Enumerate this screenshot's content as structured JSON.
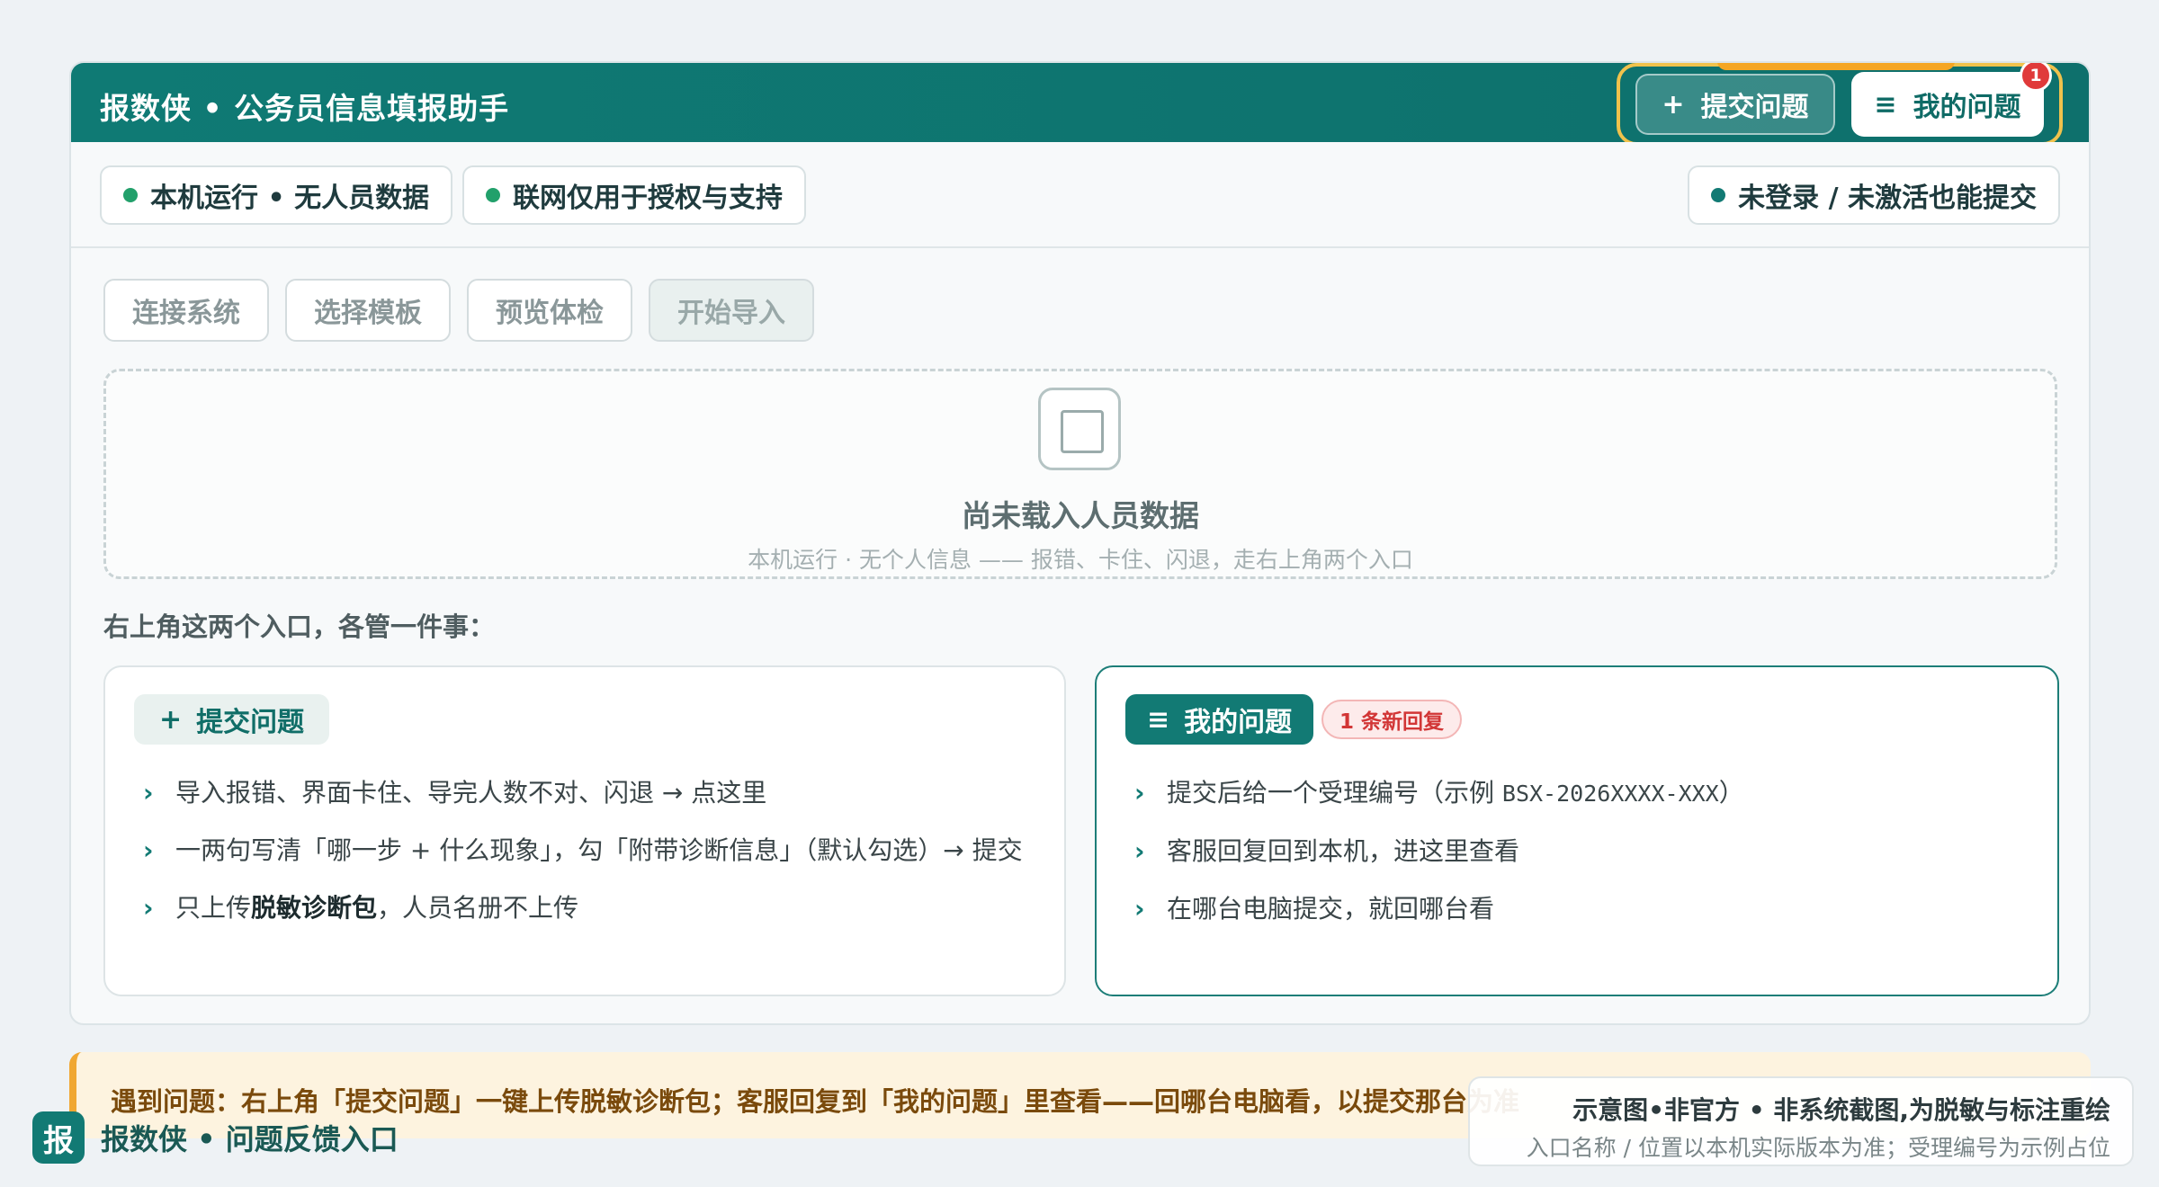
{
  "app": {
    "title": "报数侠 • 公务员信息填报助手",
    "submit_label": "提交问题",
    "submit_icon": "+",
    "mine_label": "我的问题",
    "mine_icon": "≡",
    "badge_count": "1"
  },
  "status": {
    "local": "本机运行 • 无人员数据",
    "network": "联网仅用于授权与支持",
    "login": "未登录 / 未激活也能提交"
  },
  "steps": [
    "连接系统",
    "选择模板",
    "预览体检",
    "开始导入"
  ],
  "dropzone": {
    "title": "尚未载入人员数据",
    "subtitle": "本机运行 · 无个人信息 —— 报错、卡住、闪退，走右上角两个入口"
  },
  "section_label": "右上角这两个入口，各管一件事：",
  "card_submit": {
    "icon": "+",
    "title": "提交问题",
    "items": [
      "导入报错、界面卡住、导完人数不对、闪退 → 点这里",
      "一两句写清「哪一步 + 什么现象」，勾「附带诊断信息」（默认勾选）→ 提交"
    ],
    "item3_prefix": "只上传",
    "item3_bold": "脱敏诊断包",
    "item3_suffix": "，人员名册不上传"
  },
  "card_mine": {
    "icon": "≡",
    "title": "我的问题",
    "new_reply": "1 条新回复",
    "item1_prefix": "提交后给一个受理编号（示例 ",
    "item1_code": "BSX-2026XXXX-XXX",
    "item1_suffix": "）",
    "items": [
      "客服回复回到本机，进这里查看",
      "在哪台电脑提交，就回哪台看"
    ]
  },
  "notice": "遇到问题：右上角「提交问题」一键上传脱敏诊断包；客服回复到「我的问题」里查看——回哪台电脑看，以提交那台为准",
  "footer": {
    "logo": "报",
    "brand": "报数侠 • 问题反馈入口"
  },
  "disclaimer": {
    "title": "示意图•非官方 • 非系统截图,为脱敏与标注重绘",
    "subtitle": "入口名称 / 位置以本机实际版本为准；受理编号为示例占位"
  },
  "colors": {
    "primary": "#127a74",
    "accent": "#f0c24c",
    "badge": "#e03a3a",
    "notice_bg": "#fdf3df"
  }
}
